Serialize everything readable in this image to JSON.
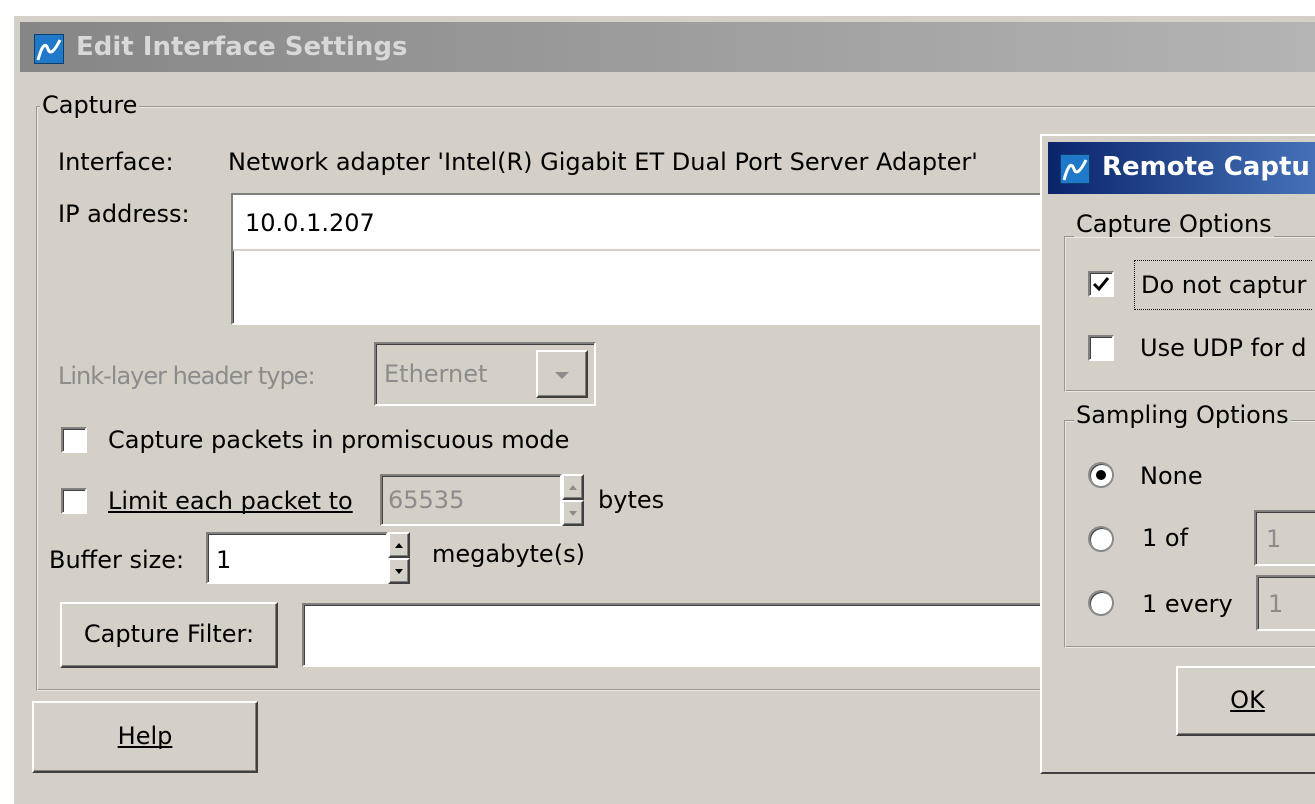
{
  "edit_window": {
    "title": "Edit Interface Settings",
    "capture_group": {
      "legend": "Capture",
      "interface_label": "Interface:",
      "interface_value": "Network adapter 'Intel(R) Gigabit ET Dual Port Server Adapter'",
      "ip_label": "IP address:",
      "ip_value": "10.0.1.207",
      "link_layer_label": "Link-layer header type:",
      "link_layer_value": "Ethernet",
      "promiscuous_label": "Capture packets in promiscuous mode",
      "promiscuous_checked": false,
      "limit_label": "Limit each packet to",
      "limit_checked": false,
      "limit_value": "65535",
      "limit_unit": "bytes",
      "buffer_label": "Buffer size:",
      "buffer_value": "1",
      "buffer_unit": "megabyte(s)",
      "capture_filter_button": "Capture Filter:",
      "capture_filter_value": ""
    },
    "help_button": "Help"
  },
  "remote_window": {
    "title": "Remote Captu",
    "capture_options": {
      "legend": "Capture Options",
      "do_not_capture_label": "Do not captur",
      "do_not_capture_checked": true,
      "use_udp_label": "Use UDP for d",
      "use_udp_checked": false
    },
    "sampling_options": {
      "legend": "Sampling Options",
      "selected": "None",
      "none_label": "None",
      "one_of_label": "1 of",
      "one_of_value": "1",
      "one_every_label": "1 every",
      "one_every_value": "1"
    },
    "ok_button": "OK"
  },
  "colors": {
    "dialog_background": "#d4d0c8",
    "titlebar_inactive": "#9a9a9a",
    "titlebar_active": "#0a246a",
    "disabled_text": "#8c8c8c"
  }
}
